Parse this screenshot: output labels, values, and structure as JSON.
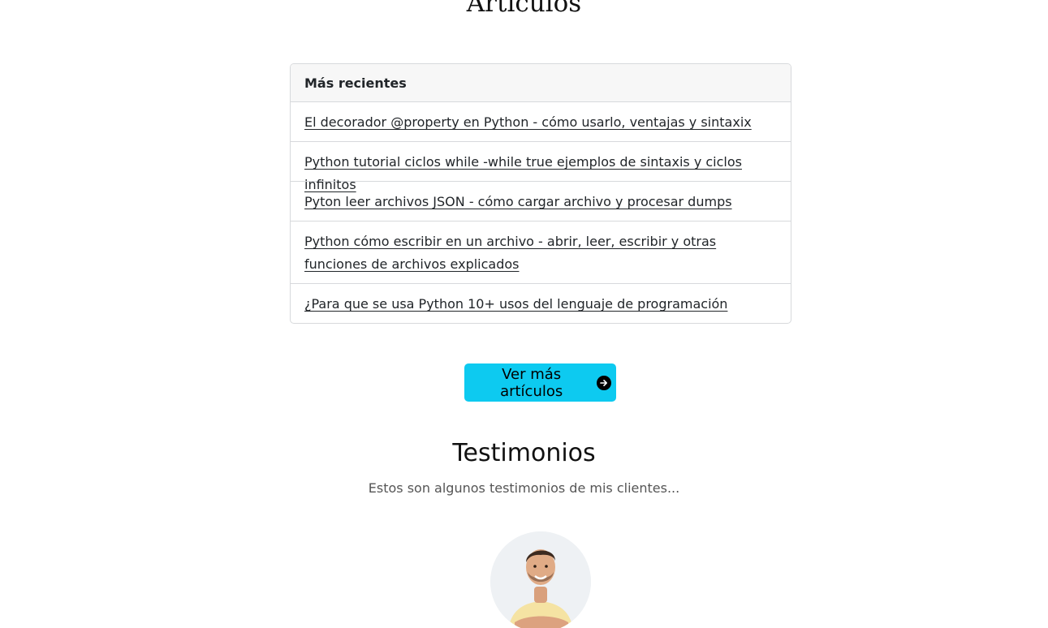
{
  "articles": {
    "title": "Artículos",
    "card_header": "Más recientes",
    "items": [
      {
        "label": "El decorador @property en Python - cómo usarlo, ventajas y sintaxix"
      },
      {
        "label": "Python tutorial ciclos while -while true ejemplos de sintaxis y ciclos infinitos"
      },
      {
        "label": "Pyton leer archivos JSON - cómo cargar archivo y procesar dumps"
      },
      {
        "label": "Python cómo escribir en un archivo - abrir, leer, escribir y otras funciones de archivos explicados"
      },
      {
        "label": "¿Para que se usa Python 10+ usos del lenguaje de programación"
      }
    ],
    "more_button_label": "Ver más artículos",
    "more_button_icon": "arrow-right-circle-icon",
    "accent_color": "#0dcaf0"
  },
  "testimonials": {
    "title": "Testimonios",
    "subtitle": "Estos son algunos testimonios de mis clientes..."
  }
}
